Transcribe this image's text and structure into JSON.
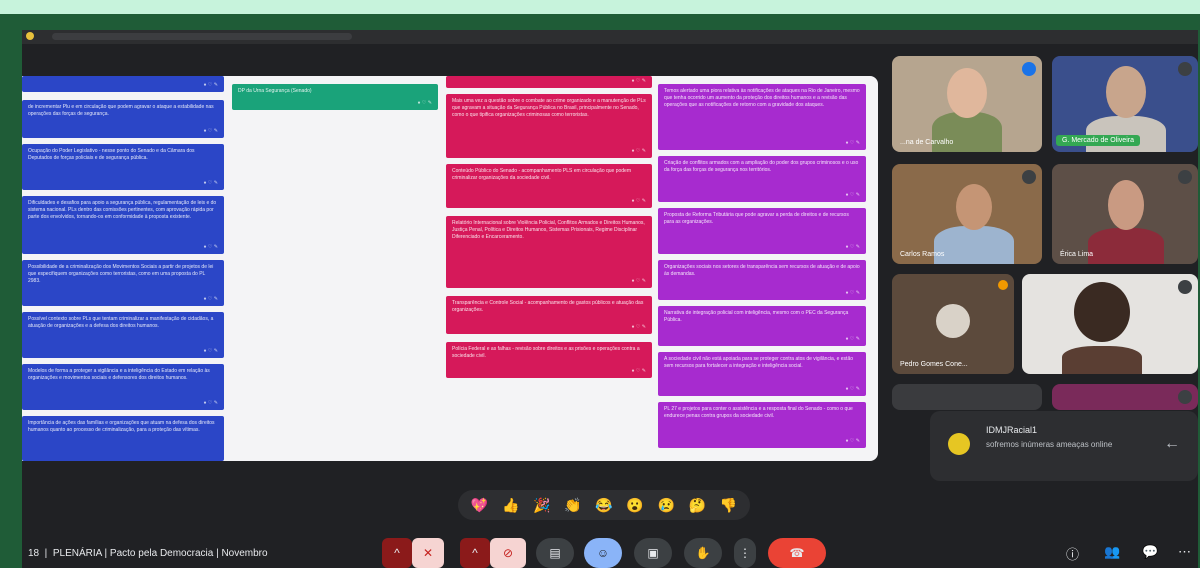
{
  "meeting": {
    "title": "PLENÁRIA | Pacto pela Democracia | Novembro",
    "time_prefix": "18"
  },
  "participants": [
    {
      "name": "...na de Carvalho",
      "mic": "blue-wave"
    },
    {
      "name": "G. Mercado de Oliveira",
      "mic": "muted"
    },
    {
      "name": "Carlos Ramos",
      "mic": "muted"
    },
    {
      "name": "Érica Lima",
      "mic": "muted"
    },
    {
      "name": "Pedro Gomes Cone...",
      "mic": "raised-hand"
    },
    {
      "name": "",
      "mic": "muted"
    }
  ],
  "chat_notification": {
    "sender": "IDMJRacial1",
    "message": "sofremos inúmeras ameaças online"
  },
  "reactions": [
    "💖",
    "👍",
    "🎉",
    "👏",
    "😂",
    "😮",
    "😢",
    "🤔",
    "👎"
  ],
  "board": {
    "blue_notes": [
      {
        "text": ""
      },
      {
        "text": "de incrementar Plu e em circulação que podem agravar o ataque a estabilidade nas operações das forças de segurança."
      },
      {
        "text": "Ocupação do Poder Legislativo - nesse ponto do Senado e da Câmara dos Deputados de forças policiais e de segurança pública."
      },
      {
        "text": "Dificuldades e desafios para apoio a segurança pública, regulamentação de leis e do sistema nacional. PLs dentro das comissões pertinentes, com aprovação rápida por parte dos envolvidos, tornando-os em conformidade à proposta existente."
      },
      {
        "text": "Possibilidade de a criminalização dos Movimentos Sociais a partir de projetos de lei que especifiquem organizações como terroristas, como em uma proposta do PL 2983."
      },
      {
        "text": "Possível contexto sobre PLs que tentam criminalizar a manifestação de cidadãos, a atuação de organizações e a defesa dos direitos humanos."
      },
      {
        "text": "Modelos de forma a proteger a vigilância e a inteligência do Estado em relação às organizações e movimentos sociais e defensores dos direitos humanos."
      },
      {
        "text": "Importância de ações das famílias e organizações que atuam na defesa dos direitos humanos quanto ao processo de criminalização, para a proteção das vítimas."
      }
    ],
    "green_notes": [
      {
        "text": "DP da Urna Segurança (Senado)"
      }
    ],
    "red_notes": [
      {
        "text": ""
      },
      {
        "text": "Mais uma vez a questão sobre o combate ao crime organizado e a manutenção de PLs que agravam a situação da Segurança Pública no Brasil, principalmente no Senado, como o que tipifica organizações criminosas como terroristas."
      },
      {
        "text": "Conteúdo Público do Senado - acompanhamento PLS em circulação que podem criminalizar organizações da sociedade civil."
      },
      {
        "text": "Relatório Internacional sobre Violência Policial, Conflitos Armados e Direitos Humanos, Justiça Penal, Política e Direitos Humanos, Sistemas Prisionais, Regime Disciplinar Diferenciado e Encarceramento."
      },
      {
        "text": "Transparência e Controle Social - acompanhamento de gastos públicos e atuação das organizações."
      },
      {
        "text": "Polícia Federal e as falhas - revisão sobre direitos e as prisões e operações contra a sociedade civil."
      }
    ],
    "purple_notes": [
      {
        "text": "Temos alertado uma piora relativa às notificações de ataques na Rio de Janeiro, mesmo que tenha ocorrido um aumento da proteção dos direitos humanos e a revisão das operações que as notificações de retorno com a gravidade dos ataques."
      },
      {
        "text": "Criação de conflitos armados com a ampliação do poder dos grupos criminosos e o uso da força das forças de segurança nos territórios."
      },
      {
        "text": "Proposta de Reforma Tributária que pode agravar a perda de direitos e de recursos para as organizações."
      },
      {
        "text": "Organizações sociais nos setores de transparência sem recursos de atuação e de apoio às demandas."
      },
      {
        "text": "Narrativa de integração policial com inteligência, mesmo com o PEC da Segurança Pública."
      },
      {
        "text": "A sociedade civil não está apoiada para se proteger contra atos de vigilância, e estão sem recursos para fortalecer a integração e inteligência social."
      },
      {
        "text": "PL 27 e projetos para conter o assistência e a resposta final do Senado - como o que endurece penas contra grupos da sociedade civil."
      }
    ]
  },
  "colors": {
    "blue": "#2b46c7",
    "green": "#1aa37a",
    "red": "#d6195a",
    "purple": "#a72bcf",
    "frame": "#1f5c37",
    "leave": "#ea4335"
  }
}
